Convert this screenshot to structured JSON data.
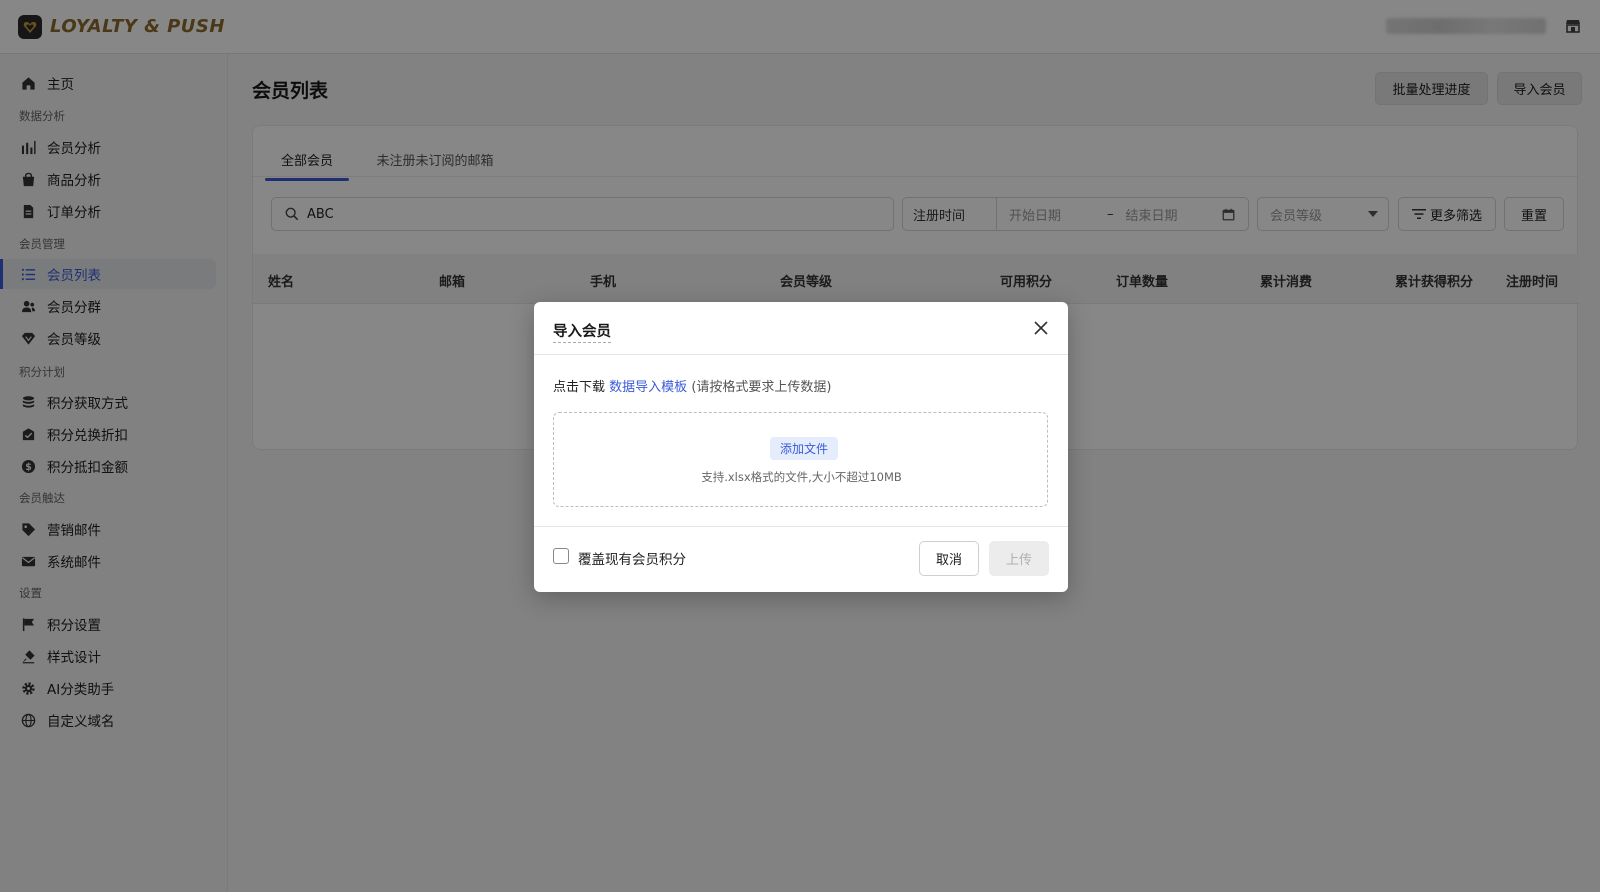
{
  "app": {
    "brand": "LOYALTY & PUSH"
  },
  "sidebar": {
    "items": [
      {
        "label": "主页",
        "icon": "home-icon"
      },
      {
        "group": "数据分析"
      },
      {
        "label": "会员分析",
        "icon": "bar-chart-icon"
      },
      {
        "label": "商品分析",
        "icon": "bag-icon"
      },
      {
        "label": "订单分析",
        "icon": "document-icon"
      },
      {
        "group": "会员管理"
      },
      {
        "label": "会员列表",
        "icon": "list-icon",
        "active": true
      },
      {
        "label": "会员分群",
        "icon": "users-icon"
      },
      {
        "label": "会员等级",
        "icon": "diamond-icon"
      },
      {
        "group": "积分计划"
      },
      {
        "label": "积分获取方式",
        "icon": "coin-stack-icon"
      },
      {
        "label": "积分兑换折扣",
        "icon": "discount-envelope-icon"
      },
      {
        "label": "积分抵扣金额",
        "icon": "dollar-coin-icon"
      },
      {
        "group": "会员触达"
      },
      {
        "label": "营销邮件",
        "icon": "tag-icon"
      },
      {
        "label": "系统邮件",
        "icon": "mail-icon"
      },
      {
        "group": "设置"
      },
      {
        "label": "积分设置",
        "icon": "flag-icon"
      },
      {
        "label": "样式设计",
        "icon": "paint-icon"
      },
      {
        "label": "AI分类助手",
        "icon": "gear-icon"
      },
      {
        "label": "自定义域名",
        "icon": "globe-icon"
      }
    ]
  },
  "header": {
    "title": "会员列表",
    "batch_progress_label": "批量处理进度",
    "import_label": "导入会员"
  },
  "tabs": [
    {
      "label": "全部会员",
      "active": true
    },
    {
      "label": "未注册未订阅的邮箱",
      "active": false
    }
  ],
  "filters": {
    "search_value": "ABC",
    "date_label": "注册时间",
    "start_placeholder": "开始日期",
    "range_sep": "–",
    "end_placeholder": "结束日期",
    "level_placeholder": "会员等级",
    "more_label": "更多筛选",
    "reset_label": "重置"
  },
  "table": {
    "columns": [
      "姓名",
      "邮箱",
      "手机",
      "会员等级",
      "可用积分",
      "订单数量",
      "累计消费",
      "累计获得积分",
      "注册时间"
    ]
  },
  "modal": {
    "title": "导入会员",
    "download_prefix": "点击下载",
    "download_link": "数据导入模板",
    "download_hint": "(请按格式要求上传数据)",
    "add_file_label": "添加文件",
    "file_hint": "支持.xlsx格式的文件,大小不超过10MB",
    "overwrite_label": "覆盖现有会员积分",
    "cancel_label": "取消",
    "upload_label": "上传"
  },
  "colors": {
    "accent": "#3a5bd9",
    "brand": "#8c6a2c",
    "overlay": "rgba(0,0,0,0.47)"
  }
}
